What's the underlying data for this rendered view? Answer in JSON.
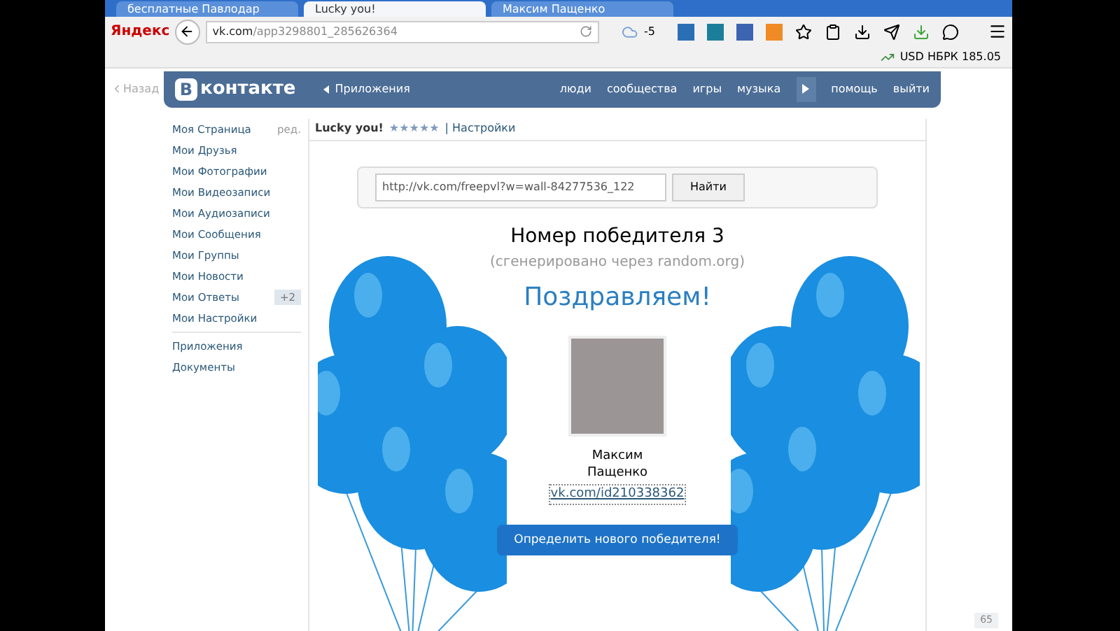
{
  "browser": {
    "tabs": [
      {
        "title": "бесплатные Павлодар",
        "selected": false
      },
      {
        "title": "Lucky you!",
        "selected": true
      },
      {
        "title": "Максим Пащенко",
        "selected": false
      }
    ],
    "brand": "Яндекс",
    "address": {
      "host": "vk.com",
      "path": "/app3298801_285626364"
    },
    "weather": "-5",
    "currency": "USD НБРК 185.05"
  },
  "header": {
    "back": "Назад",
    "logo_letter": "В",
    "logo_text": "контакте",
    "section": "Приложения",
    "nav": [
      "люди",
      "сообщества",
      "игры",
      "музыка",
      "помощь",
      "выйти"
    ]
  },
  "sidebar": {
    "items": [
      {
        "label": "Моя Страница",
        "extra": "ред."
      },
      {
        "label": "Мои Друзья"
      },
      {
        "label": "Мои Фотографии"
      },
      {
        "label": "Мои Видеозаписи"
      },
      {
        "label": "Мои Аудиозаписи"
      },
      {
        "label": "Мои Сообщения"
      },
      {
        "label": "Мои Группы"
      },
      {
        "label": "Мои Новости"
      },
      {
        "label": "Мои Ответы",
        "badge": "+2"
      },
      {
        "label": "Мои Настройки"
      }
    ],
    "extra_items": [
      "Приложения",
      "Документы"
    ]
  },
  "app": {
    "title": "Lucky you!",
    "stars": 5,
    "settings": "| Настройки",
    "search": {
      "value": "http://vk.com/freepvl?w=wall-84277536_122",
      "button": "Найти"
    },
    "winner_heading": "Номер победителя 3",
    "winner_note": "(сгенерировано через random.org)",
    "congrats": "Поздравляем!",
    "first_name": "Максим",
    "last_name": "Пащенко",
    "profile_link": "vk.com/id210338362",
    "action": "Определить нового победителя!"
  },
  "side_widget": "65"
}
